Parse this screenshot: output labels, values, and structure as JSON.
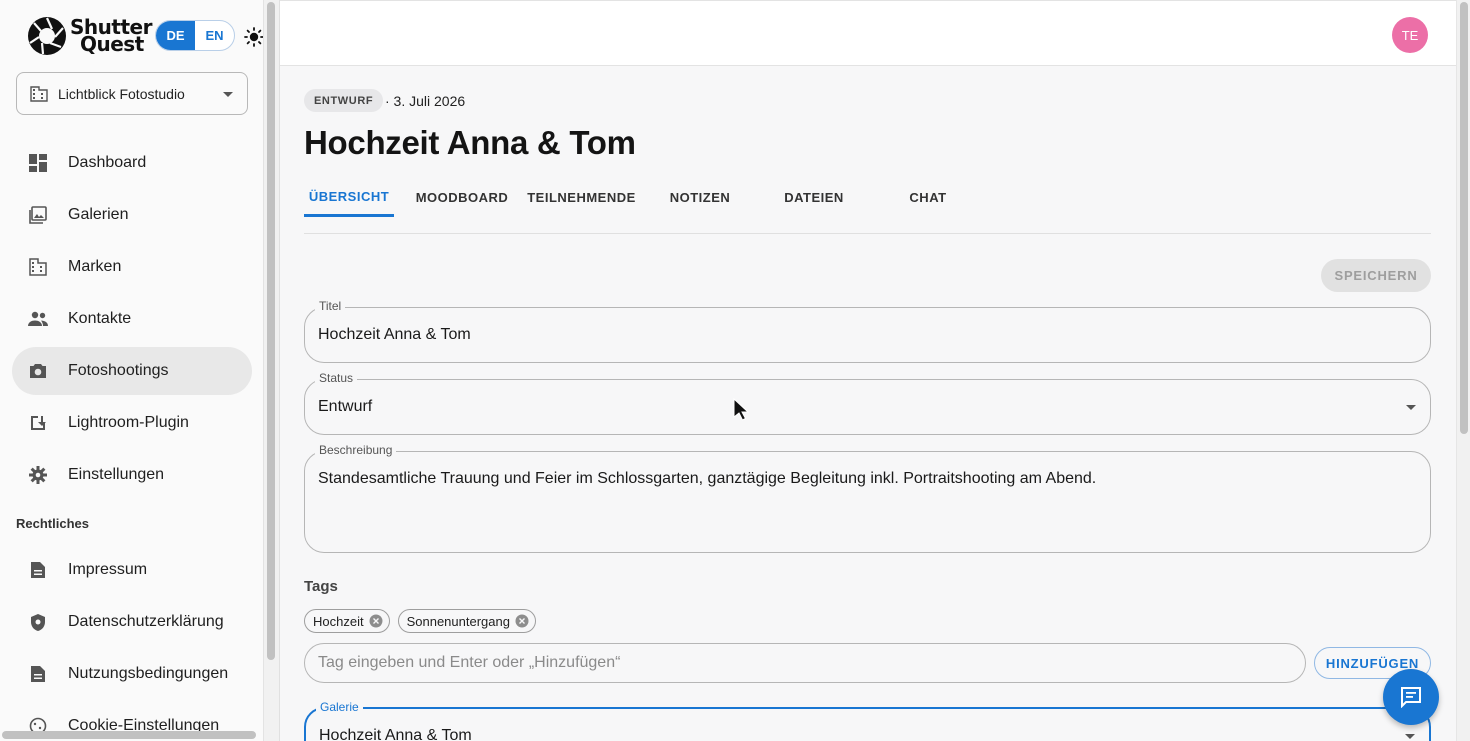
{
  "brand": {
    "logo_text_line1": "Shutter",
    "logo_text_line2": "Quest"
  },
  "language": {
    "options": [
      "DE",
      "EN"
    ],
    "active": "DE"
  },
  "studio": {
    "selected": "Lichtblick Fotostudio"
  },
  "sidebar": {
    "items": [
      {
        "label": "Dashboard",
        "icon": "dashboard-icon"
      },
      {
        "label": "Galerien",
        "icon": "photo-library-icon"
      },
      {
        "label": "Marken",
        "icon": "building-icon"
      },
      {
        "label": "Kontakte",
        "icon": "people-icon"
      },
      {
        "label": "Fotoshootings",
        "icon": "camera-icon",
        "active": true
      },
      {
        "label": "Lightroom-Plugin",
        "icon": "download-icon"
      },
      {
        "label": "Einstellungen",
        "icon": "gear-icon"
      }
    ],
    "section_legal": "Rechtliches",
    "legal_items": [
      {
        "label": "Impressum",
        "icon": "document-icon"
      },
      {
        "label": "Datenschutzerklärung",
        "icon": "shield-icon"
      },
      {
        "label": "Nutzungsbedingungen",
        "icon": "document-icon"
      },
      {
        "label": "Cookie-Einstellungen",
        "icon": "cookie-icon"
      }
    ]
  },
  "user": {
    "initials": "TE",
    "avatar_color": "#ec6fa7"
  },
  "shooting": {
    "status_badge": "ENTWURF",
    "date": "· 3. Juli 2026",
    "title": "Hochzeit Anna & Tom"
  },
  "tabs": [
    {
      "label": "ÜBERSICHT",
      "active": true
    },
    {
      "label": "MOODBOARD"
    },
    {
      "label": "TEILNEHMENDE"
    },
    {
      "label": "NOTIZEN"
    },
    {
      "label": "DATEIEN"
    },
    {
      "label": "CHAT"
    }
  ],
  "form": {
    "save_label": "SPEICHERN",
    "title": {
      "label": "Titel",
      "value": "Hochzeit Anna & Tom"
    },
    "status": {
      "label": "Status",
      "value": "Entwurf"
    },
    "description": {
      "label": "Beschreibung",
      "value": "Standesamtliche Trauung und Feier im Schlossgarten, ganztägige Begleitung inkl. Portraitshooting am Abend."
    },
    "tags_label": "Tags",
    "tags": [
      "Hochzeit",
      "Sonnenuntergang"
    ],
    "tag_placeholder": "Tag eingeben und Enter oder „Hinzufügen“",
    "add_label": "HINZUFÜGEN",
    "gallery": {
      "label": "Galerie",
      "value": "Hochzeit Anna & Tom"
    }
  },
  "colors": {
    "accent": "#1976d2"
  }
}
